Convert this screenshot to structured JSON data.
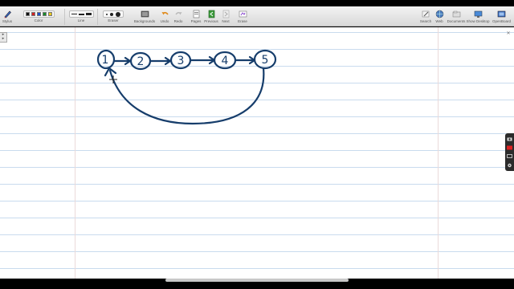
{
  "toolbar": {
    "stylus_label": "Stylus",
    "color_label": "Color",
    "line_label": "Line",
    "eraser_label": "Eraser",
    "backgrounds_label": "Backgrounds",
    "undo_label": "Undo",
    "redo_label": "Redo",
    "pages_label": "Pages",
    "previous_label": "Previous",
    "next_label": "Next",
    "erase_label": "Erase",
    "search_label": "Search",
    "web_label": "Web",
    "documents_label": "Documents",
    "show_desktop_label": "Show Desktop",
    "openboard_label": "OpenBoard",
    "colors": [
      "#111111",
      "#d42020",
      "#1e4fc8",
      "#1a8a2a",
      "#e8c820"
    ]
  },
  "diagram": {
    "nodes": [
      "1",
      "2",
      "3",
      "4",
      "5"
    ],
    "ink_color": "#163d6b"
  },
  "panel": {
    "icons": [
      "camera-icon",
      "record-icon",
      "screen-icon",
      "settings-icon"
    ]
  }
}
